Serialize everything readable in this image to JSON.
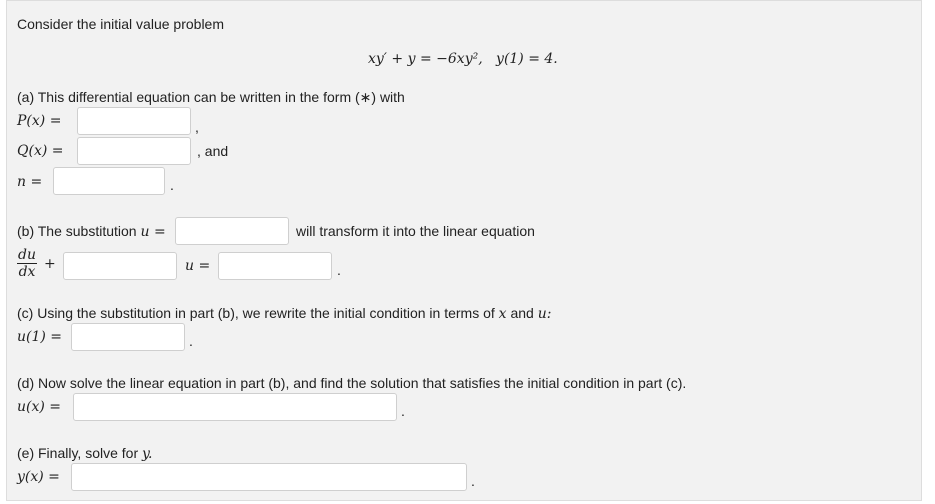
{
  "intro": "Consider the initial value problem",
  "equation": {
    "lhs": "xy′ + y = −6xy²,",
    "ic": "y(1) = 4."
  },
  "part_a": {
    "text": "(a) This differential equation can be written in the form (∗) with",
    "p_label": "P(x) =",
    "q_label": "Q(x) =",
    "n_label": "n =",
    "comma": ",",
    "and": ", and",
    "period": "."
  },
  "part_b": {
    "text": "(b) The substitution",
    "u_eq": "u =",
    "after_text": "will transform it into the linear equation",
    "frac_num": "du",
    "frac_den": "dx",
    "plus": "+",
    "u_eq2": "u =",
    "period": "."
  },
  "part_c": {
    "text": "(c) Using the substitution in part (b), we rewrite the initial condition in terms of",
    "var_x": "x",
    "and": "and",
    "var_u": "u:",
    "label": "u(1) =",
    "period": "."
  },
  "part_d": {
    "text": "(d) Now solve the linear equation in part (b), and find the solution that satisfies the initial condition in part (c).",
    "label": "u(x) =",
    "period": "."
  },
  "part_e": {
    "text": "(e) Finally, solve for",
    "var": "y.",
    "label": "y(x) =",
    "period": "."
  },
  "inputs": {
    "p_value": "",
    "q_value": "",
    "n_value": "",
    "sub_value": "",
    "lin_coef": "",
    "lin_rhs": "",
    "u1_value": "",
    "ux_value": "",
    "yx_value": ""
  }
}
